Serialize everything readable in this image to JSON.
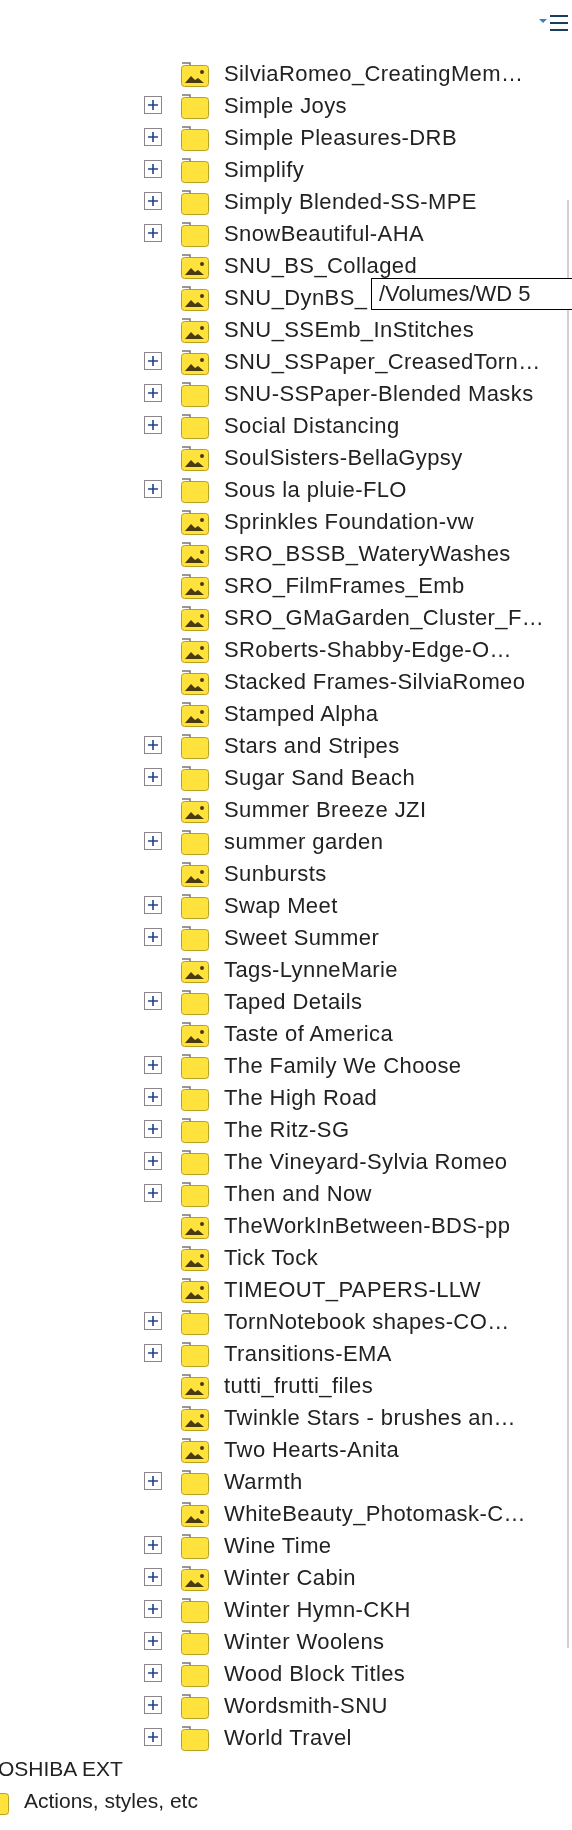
{
  "tree": {
    "items": [
      {
        "label": "SilviaRomeo_CreatingMem…",
        "kind": "image_folder",
        "expandable": false
      },
      {
        "label": "Simple Joys",
        "kind": "folder",
        "expandable": true
      },
      {
        "label": "Simple Pleasures-DRB",
        "kind": "folder",
        "expandable": true
      },
      {
        "label": "Simplify",
        "kind": "folder",
        "expandable": true
      },
      {
        "label": "Simply Blended-SS-MPE",
        "kind": "folder",
        "expandable": true
      },
      {
        "label": "SnowBeautiful-AHA",
        "kind": "folder",
        "expandable": true
      },
      {
        "label": "SNU_BS_Collaged",
        "kind": "image_folder",
        "expandable": false
      },
      {
        "label": "SNU_DynBS_",
        "kind": "image_folder",
        "expandable": false
      },
      {
        "label": "SNU_SSEmb_InStitches",
        "kind": "image_folder",
        "expandable": false
      },
      {
        "label": "SNU_SSPaper_CreasedTorn…",
        "kind": "image_folder",
        "expandable": true
      },
      {
        "label": "SNU-SSPaper-Blended Masks",
        "kind": "folder",
        "expandable": true
      },
      {
        "label": "Social Distancing",
        "kind": "folder",
        "expandable": true
      },
      {
        "label": "SoulSisters-BellaGypsy",
        "kind": "image_folder",
        "expandable": false
      },
      {
        "label": "Sous la pluie-FLO",
        "kind": "folder",
        "expandable": true
      },
      {
        "label": "Sprinkles Foundation-vw",
        "kind": "image_folder",
        "expandable": false
      },
      {
        "label": "SRO_BSSB_WateryWashes",
        "kind": "image_folder",
        "expandable": false
      },
      {
        "label": "SRO_FilmFrames_Emb",
        "kind": "image_folder",
        "expandable": false
      },
      {
        "label": "SRO_GMaGarden_Cluster_F…",
        "kind": "image_folder",
        "expandable": false
      },
      {
        "label": "SRoberts-Shabby-Edge-O…",
        "kind": "image_folder",
        "expandable": false
      },
      {
        "label": "Stacked Frames-SilviaRomeo",
        "kind": "image_folder",
        "expandable": false
      },
      {
        "label": "Stamped Alpha",
        "kind": "image_folder",
        "expandable": false
      },
      {
        "label": "Stars and Stripes",
        "kind": "folder",
        "expandable": true
      },
      {
        "label": "Sugar Sand Beach",
        "kind": "folder",
        "expandable": true
      },
      {
        "label": "Summer Breeze JZI",
        "kind": "image_folder",
        "expandable": false
      },
      {
        "label": "summer garden",
        "kind": "folder",
        "expandable": true
      },
      {
        "label": "Sunbursts",
        "kind": "image_folder",
        "expandable": false
      },
      {
        "label": "Swap Meet",
        "kind": "folder",
        "expandable": true
      },
      {
        "label": "Sweet Summer",
        "kind": "folder",
        "expandable": true
      },
      {
        "label": "Tags-LynneMarie",
        "kind": "image_folder",
        "expandable": false
      },
      {
        "label": "Taped Details",
        "kind": "folder",
        "expandable": true
      },
      {
        "label": "Taste of America",
        "kind": "image_folder",
        "expandable": false
      },
      {
        "label": "The Family We Choose",
        "kind": "folder",
        "expandable": true
      },
      {
        "label": "The High Road",
        "kind": "folder",
        "expandable": true
      },
      {
        "label": "The Ritz-SG",
        "kind": "folder",
        "expandable": true
      },
      {
        "label": "The Vineyard-Sylvia Romeo",
        "kind": "folder",
        "expandable": true
      },
      {
        "label": "Then and Now",
        "kind": "folder",
        "expandable": true
      },
      {
        "label": "TheWorkInBetween-BDS-pp",
        "kind": "image_folder",
        "expandable": false
      },
      {
        "label": "Tick Tock",
        "kind": "image_folder",
        "expandable": false
      },
      {
        "label": "TIMEOUT_PAPERS-LLW",
        "kind": "image_folder",
        "expandable": false
      },
      {
        "label": "TornNotebook shapes-CO…",
        "kind": "folder",
        "expandable": true
      },
      {
        "label": "Transitions-EMA",
        "kind": "folder",
        "expandable": true
      },
      {
        "label": "tutti_frutti_files",
        "kind": "image_folder",
        "expandable": false
      },
      {
        "label": "Twinkle Stars - brushes an…",
        "kind": "image_folder",
        "expandable": false
      },
      {
        "label": "Two Hearts-Anita",
        "kind": "image_folder",
        "expandable": false
      },
      {
        "label": "Warmth",
        "kind": "folder",
        "expandable": true
      },
      {
        "label": "WhiteBeauty_Photomask-C…",
        "kind": "image_folder",
        "expandable": false
      },
      {
        "label": "Wine Time",
        "kind": "folder",
        "expandable": true
      },
      {
        "label": "Winter Cabin",
        "kind": "image_folder",
        "expandable": true
      },
      {
        "label": "Winter Hymn-CKH",
        "kind": "folder",
        "expandable": true
      },
      {
        "label": "Winter Woolens",
        "kind": "folder",
        "expandable": true
      },
      {
        "label": "Wood Block Titles",
        "kind": "folder",
        "expandable": true
      },
      {
        "label": "Wordsmith-SNU",
        "kind": "folder",
        "expandable": true
      },
      {
        "label": "World Travel",
        "kind": "folder",
        "expandable": true
      }
    ]
  },
  "tooltip": "/Volumes/WD 5",
  "volume": {
    "label": "OSHIBA EXT",
    "children": [
      {
        "label": "Actions, styles, etc",
        "kind": "folder"
      }
    ]
  }
}
